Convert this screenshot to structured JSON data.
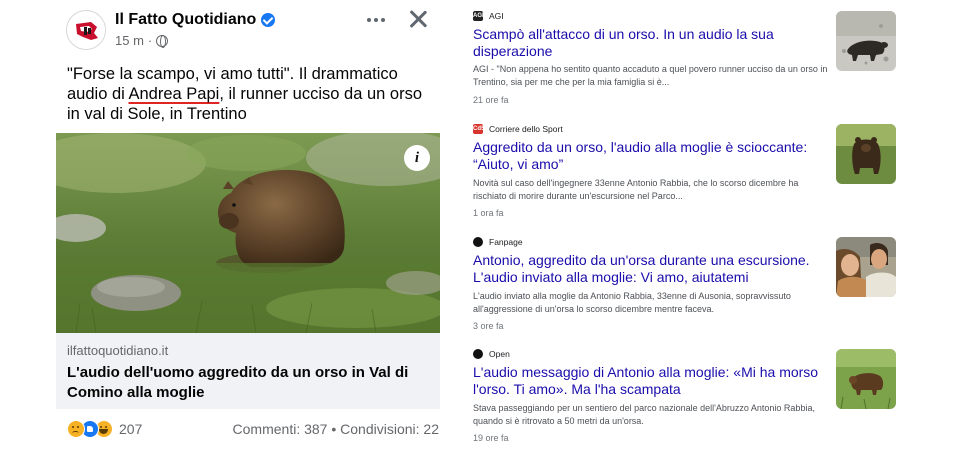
{
  "post": {
    "page_name": "Il Fatto Quotidiano",
    "time_ago": "15 m",
    "meta_separator": "·",
    "text_before": "\"Forse la scampo, vi amo tutti\". Il drammatico audio di ",
    "text_link": "Andrea Papi",
    "text_after": ", il runner ucciso da un orso in val di Sole, in Trentino",
    "info_icon": "i",
    "link_domain": "ilfattoquotidiano.it",
    "link_title": "L'audio dell'uomo aggredito da un orso in Val di Comino alla moglie",
    "reactions_count": "207",
    "comments": "Commenti: 387",
    "stats_separator": "•",
    "shares": "Condivisioni: 22"
  },
  "icons": {
    "verified": "verified-badge-icon",
    "globe": "globe-icon",
    "more": "more-options-icon",
    "close": "close-icon",
    "reactions": [
      "sad-reaction-icon",
      "like-reaction-icon",
      "haha-reaction-icon"
    ]
  },
  "news": [
    {
      "source": "AGI",
      "logo_text": "AGI",
      "title": "Scampò all'attacco di un orso. In un audio la sua disperazione",
      "snippet": "AGI - \"Non appena ho sentito quanto accaduto a quel povero runner ucciso da un orso in Trentino, sia per me che per la mia famiglia si è...",
      "time": "21 ore fa"
    },
    {
      "source": "Corriere dello Sport",
      "logo_text": "CdS",
      "title": "Aggredito da un orso, l'audio alla moglie è scioccante: “Aiuto, vi amo”",
      "snippet": "Novità sul caso dell'ingegnere 33enne Antonio Rabbia, che lo scorso dicembre ha rischiato di morire durante un'escursione nel Parco...",
      "time": "1 ora fa"
    },
    {
      "source": "Fanpage",
      "logo_text": "",
      "title": "Antonio, aggredito da un'orsa durante una escursione. L'audio inviato alla moglie: Vi amo, aiutatemi",
      "snippet": "L'audio inviato alla moglie da Antonio Rabbia, 33enne di Ausonia, sopravvissuto all'aggressione di un'orsa lo scorso dicembre mentre faceva.",
      "time": "3 ore fa"
    },
    {
      "source": "Open",
      "logo_text": "",
      "title": "L'audio messaggio di Antonio alla moglie: «Mi ha morso l'orso. Ti amo». Ma l'ha scampata",
      "snippet": "Stava passeggiando per un sentiero del parco nazionale dell'Abruzzo Antonio Rabbia, quando si è ritrovato a 50 metri da un'orsa.",
      "time": "19 ore fa"
    }
  ],
  "colors": {
    "news_title": "#1a0dab",
    "verified": "#1877f2",
    "link_underline": "#e02424",
    "link_preview_bg": "#f0f2f5"
  }
}
